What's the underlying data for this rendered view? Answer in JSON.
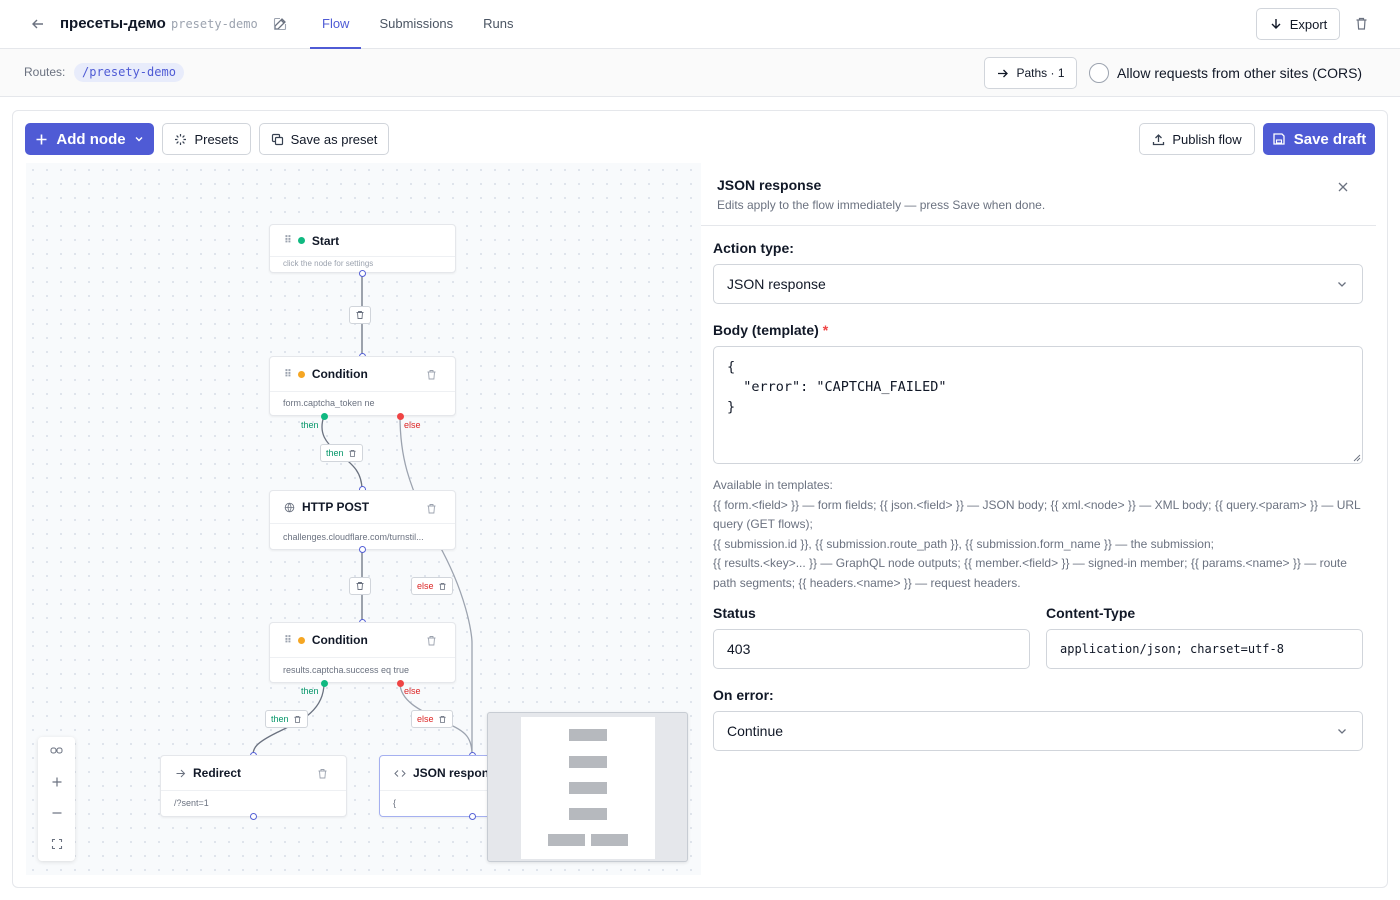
{
  "header": {
    "title": "пресеты-демо",
    "slug": "presety-demo",
    "tabs": [
      {
        "label": "Flow"
      },
      {
        "label": "Submissions"
      },
      {
        "label": "Runs"
      }
    ],
    "export_label": "Export"
  },
  "subbar": {
    "routes_label": "Routes:",
    "route": "/presety-demo",
    "paths_label": "Paths · 1",
    "cors_label": "Allow requests from other sites (CORS)",
    "cors_checked": false
  },
  "toolbar": {
    "add_node_label": "Add node",
    "presets_label": "Presets",
    "save_preset_label": "Save as preset",
    "publish_label": "Publish flow",
    "save_draft_label": "Save draft"
  },
  "nodes": [
    {
      "title": "Start",
      "subtitle": "click the node for settings",
      "kind": "start"
    },
    {
      "title": "Condition",
      "subtitle": "form.captcha_token ne",
      "kind": "condition"
    },
    {
      "title": "HTTP POST",
      "subtitle": "challenges.cloudflare.com/turnstil...",
      "kind": "http"
    },
    {
      "title": "Condition",
      "subtitle": "results.captcha.success eq true",
      "kind": "condition"
    },
    {
      "title": "Redirect",
      "subtitle": "/?sent=1",
      "kind": "redirect"
    },
    {
      "title": "JSON response",
      "subtitle": "{",
      "kind": "json"
    }
  ],
  "edge_labels": {
    "then": "then",
    "else": "else"
  },
  "side_panel": {
    "title": "JSON response",
    "subtitle": "Edits apply to the flow immediately — press Save when done.",
    "action_type_label": "Action type:",
    "action_type_value": "JSON response",
    "body_label": "Body (template)",
    "required_mark": "*",
    "body_value": "{\n  \"error\": \"CAPTCHA_FAILED\"\n}",
    "help_lines": [
      "Available in templates:",
      "{{ form.<field> }} — form fields; {{ json.<field> }} — JSON body; {{ xml.<node> }} — XML body; {{ query.<param> }} — URL query (GET flows);",
      "{{ submission.id }}, {{ submission.route_path }}, {{ submission.form_name }} — the submission;",
      "{{ results.<key>... }} — GraphQL node outputs; {{ member.<field> }} — signed-in member; {{ params.<name> }} — route path segments; {{ headers.<name> }} — request headers."
    ],
    "status_label": "Status",
    "status_value": "403",
    "content_type_label": "Content-Type",
    "content_type_value": "application/json; charset=utf-8",
    "on_error_label": "On error:",
    "on_error_value": "Continue"
  },
  "colors": {
    "accent": "#4f5bd5",
    "then": "#10b981",
    "else": "#ef4444",
    "condition_dot": "#f5a623",
    "start_dot": "#10b981"
  }
}
